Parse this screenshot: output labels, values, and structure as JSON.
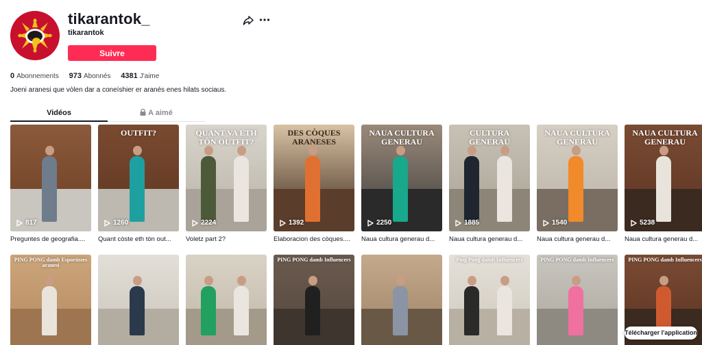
{
  "profile": {
    "username": "tikarantok_",
    "nickname": "tikarantok",
    "follow_label": "Suivre",
    "bio": "Joeni aranesi que vòlen dar a coneíshier er aranés enes hilats sociaus."
  },
  "stats": [
    {
      "value": "0",
      "label": "Abonnements"
    },
    {
      "value": "973",
      "label": "Abonnés"
    },
    {
      "value": "4381",
      "label": "J'aime"
    }
  ],
  "tabs": {
    "videos": "Vidéos",
    "liked": "A aimé"
  },
  "videos_row1": [
    {
      "views": "817",
      "caption": "Preguntes de geografia....",
      "overlay": "",
      "colors": {
        "bg": "#8b5a3c",
        "wall": "#6b3d22",
        "person": "#6e7c8c",
        "floor": "#c9c6c0"
      }
    },
    {
      "views": "1260",
      "caption": "Quant còste eth tòn out...",
      "overlay": "OUTFIT?",
      "colors": {
        "bg": "#7a4a30",
        "wall": "#5c3520",
        "person": "#1fa0a0",
        "floor": "#bdb8b0"
      }
    },
    {
      "views": "2224",
      "caption": "Voletz part 2?",
      "overlay": "QUANT VA ETH TÒN OUTFIT?",
      "colors": {
        "bg": "#d9d5cc",
        "wall": "#b6b0a4",
        "person": "#4d5a3a",
        "floor": "#a9a39a"
      }
    },
    {
      "views": "1392",
      "caption": "Elaboracion des còques....",
      "overlay": "DES CÒQUES ARANESES",
      "colors": {
        "bg": "#d8c3a5",
        "wall": "#3a2418",
        "person": "#e07030",
        "floor": "#5a3d2a"
      }
    },
    {
      "views": "2250",
      "caption": "Naua cultura generau d...",
      "overlay": "NAUA CULTURA GENERAU",
      "colors": {
        "bg": "#9b8a7a",
        "wall": "#3a3a3a",
        "person": "#18a88c",
        "floor": "#2a2a2a"
      }
    },
    {
      "views": "1885",
      "caption": "Naua cultura generau d...",
      "overlay": "CULTURA GENERAU",
      "colors": {
        "bg": "#c8c2b6",
        "wall": "#a79f92",
        "person": "#1f2630",
        "floor": "#8d8578"
      }
    },
    {
      "views": "1540",
      "caption": "Naua cultura generau d...",
      "overlay": "NAUA CULTURA GENERAU",
      "colors": {
        "bg": "#d6cfc4",
        "wall": "#b9b1a4",
        "person": "#f08a2a",
        "floor": "#7a6e62"
      }
    },
    {
      "views": "5238",
      "caption": "Naua cultura generau d...",
      "overlay": "NAUA CULTURA GENERAU",
      "colors": {
        "bg": "#7a4b33",
        "wall": "#5a3322",
        "person": "#e8e4dc",
        "floor": "#3b2a20"
      }
    }
  ],
  "videos_row2": [
    {
      "overlay": "PING PONG damb Esportistes aranesi",
      "colors": {
        "bg": "#cda57a",
        "wall": "#b38a60",
        "person": "#e8e4dc",
        "floor": "#9d7550"
      }
    },
    {
      "overlay": "",
      "colors": {
        "bg": "#e2dfd8",
        "wall": "#c9c4ba",
        "person": "#2a3a4a",
        "floor": "#b3aca0"
      }
    },
    {
      "overlay": "",
      "colors": {
        "bg": "#d9d3c6",
        "wall": "#bfb7a8",
        "person": "#22a060",
        "floor": "#a39a8a"
      }
    },
    {
      "overlay": "PING PONG damb Influencers",
      "colors": {
        "bg": "#6b5a4e",
        "wall": "#54473e",
        "person": "#202020",
        "floor": "#3e352f"
      }
    },
    {
      "overlay": "",
      "colors": {
        "bg": "#c4a98c",
        "wall": "#9d8266",
        "person": "#8a94a4",
        "floor": "#6a5846"
      }
    },
    {
      "overlay": "Ping Pong damb Influencers",
      "colors": {
        "bg": "#e4e0d8",
        "wall": "#cfc9bd",
        "person": "#2a2a2a",
        "floor": "#b8b0a3"
      }
    },
    {
      "overlay": "PING PONG damb Influencers",
      "colors": {
        "bg": "#c9c6bf",
        "wall": "#aaa69d",
        "person": "#f070a0",
        "floor": "#8e8a82"
      }
    },
    {
      "overlay": "PING PONG damb Influencers",
      "colors": {
        "bg": "#7a4b33",
        "wall": "#5a3322",
        "person": "#d05a30",
        "floor": "#3b2a20"
      }
    }
  ],
  "download_label": "Télécharger l'application",
  "colors": {
    "accent": "#fe2c55",
    "text": "#161823",
    "muted": "#8a8b91"
  }
}
